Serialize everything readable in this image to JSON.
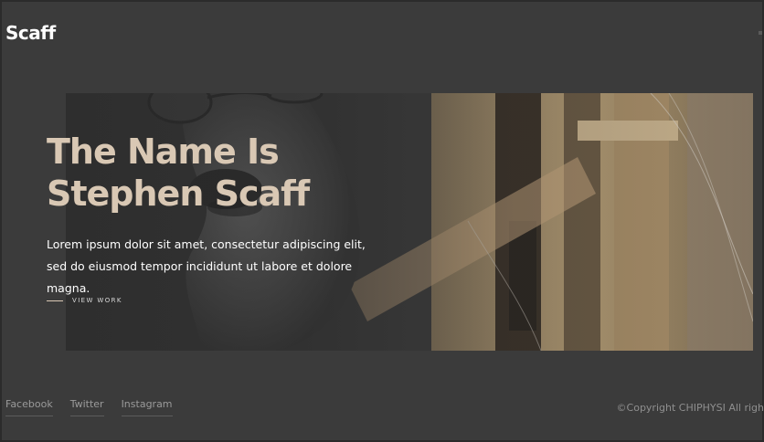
{
  "header": {
    "logo": "Scaff"
  },
  "hero": {
    "title": "The Name Is Stephen Scaff",
    "description": "Lorem ipsum dolor sit amet, consectetur adipiscing elit, sed do eiusmod tempor incididunt ut labore et dolore magna.",
    "cta_label": "VIEW WORK",
    "accent_color": "#d9c8b4"
  },
  "footer": {
    "social_links": [
      "Facebook",
      "Twitter",
      "Instagram"
    ],
    "copyright": "©Copyright CHIPHYSI All righ"
  }
}
